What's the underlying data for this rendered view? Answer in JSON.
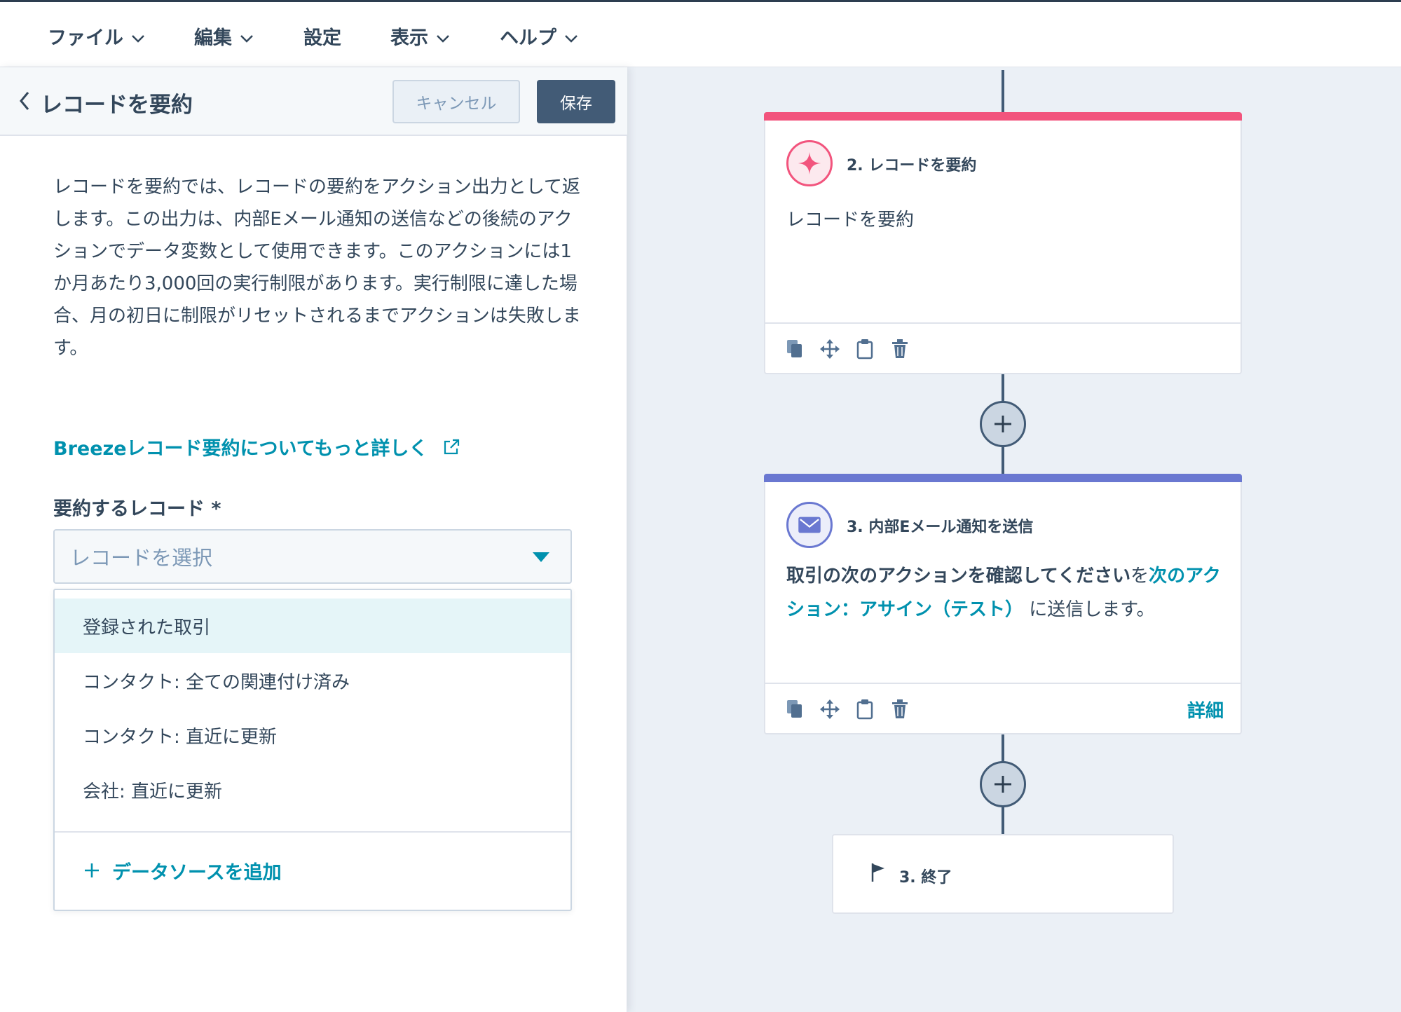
{
  "menu": {
    "items": [
      {
        "label": "ファイル",
        "has_chevron": true
      },
      {
        "label": "編集",
        "has_chevron": true
      },
      {
        "label": "設定",
        "has_chevron": false
      },
      {
        "label": "表示",
        "has_chevron": true
      },
      {
        "label": "ヘルプ",
        "has_chevron": true
      }
    ]
  },
  "panel": {
    "title": "レコードを要約",
    "cancel_label": "キャンセル",
    "save_label": "保存",
    "description": "レコードを要約では、レコードの要約をアクション出力として返します。この出力は、内部Eメール通知の送信などの後続のアクションでデータ変数として使用できます。このアクションには1か月あたり3,000回の実行制限があります。実行制限に達した場合、月の初日に制限がリセットされるまでアクションは失敗します。",
    "learn_more_link": "Breezeレコード要約についてもっと詳しく",
    "field_label": "要約するレコード *",
    "select_placeholder": "レコードを選択",
    "options": [
      "登録された取引",
      "コンタクト: 全ての関連付け済み",
      "コンタクト: 直近に更新",
      "会社: 直近に更新"
    ],
    "add_source_label": "データソースを追加"
  },
  "workflow": {
    "card1": {
      "title": "2. レコードを要約",
      "body": "レコードを要約",
      "accent_color": "#f2547d"
    },
    "card2": {
      "title": "3. 内部Eメール通知を送信",
      "body_bold": "取引の次のアクションを確認してください",
      "body_mid": "を",
      "body_link": "次のアクション：アサイン（テスト）",
      "body_tail": "に送信します。",
      "details_label": "詳細",
      "accent_color": "#6a78d1"
    },
    "end": {
      "label": "3. 終了"
    }
  },
  "icons": {
    "card1": "sparkle-icon",
    "card2": "envelope-icon",
    "tools": [
      "copy-icon",
      "move-icon",
      "clipboard-icon",
      "trash-icon"
    ],
    "end": "flag-icon"
  }
}
